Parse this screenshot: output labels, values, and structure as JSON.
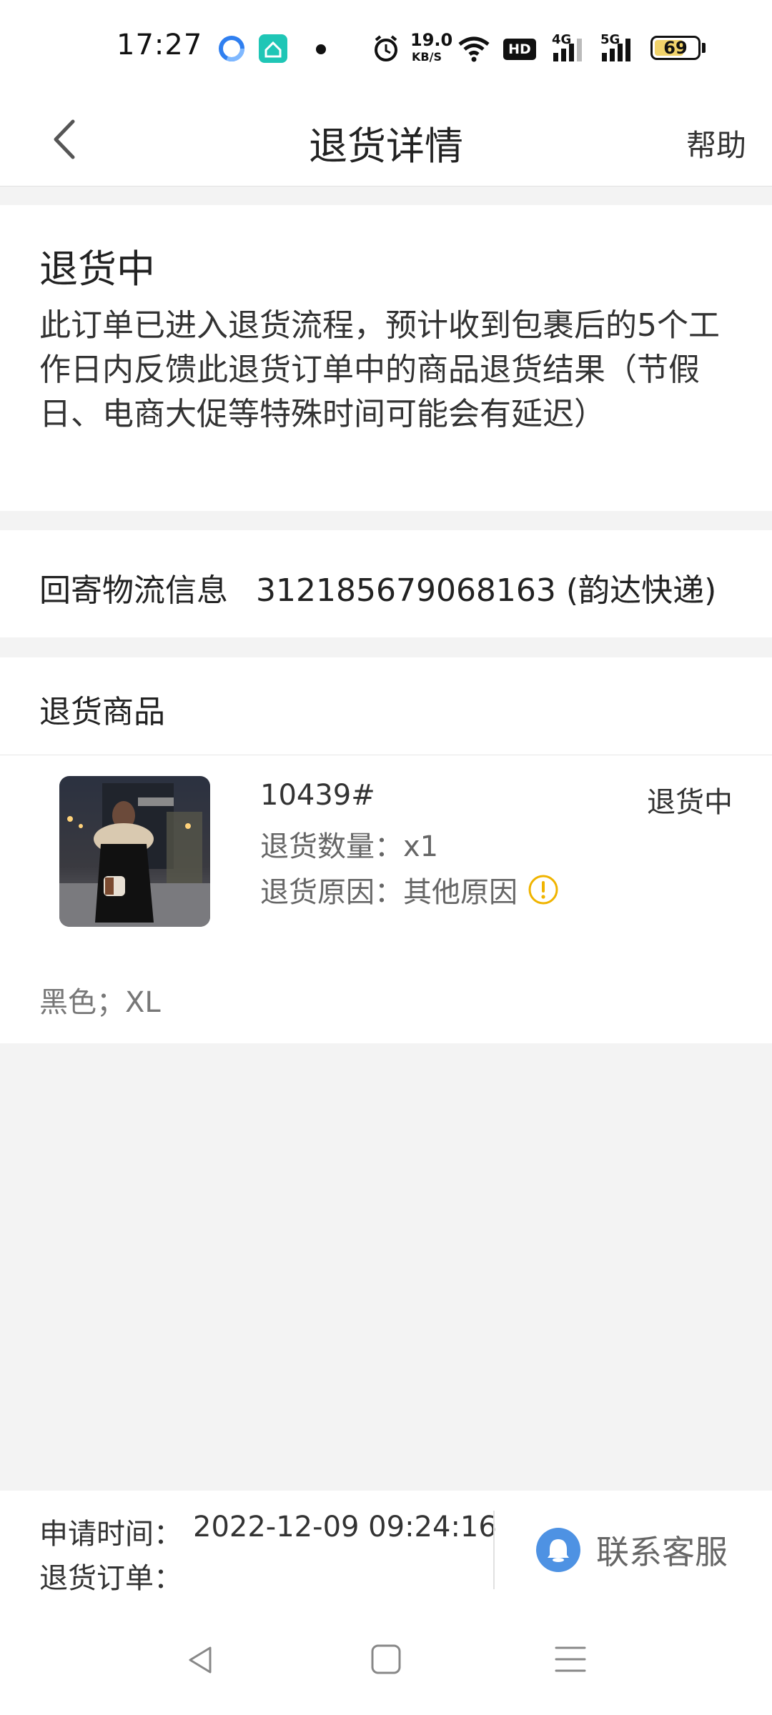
{
  "status_bar": {
    "time": "17:27",
    "net_speed_value": "19.0",
    "net_speed_unit": "KB/S",
    "hd1": "HD",
    "signal_4g": "4G",
    "signal_5g": "5G",
    "battery": "69",
    "battery_level": 0.69,
    "icons": [
      "browser-icon",
      "home-app-icon",
      "notification-dot-icon",
      "alarm-icon",
      "wifi-icon",
      "hd-voice-icon",
      "signal-4g-icon",
      "signal-5g-icon",
      "battery-icon"
    ]
  },
  "header": {
    "title": "退货详情",
    "help_label": "帮助",
    "back_icon": "chevron-left-icon"
  },
  "status": {
    "title": "退货中",
    "description": "此订单已进入退货流程，预计收到包裹后的5个工作日内反馈此退货订单中的商品退货结果（节假日、电商大促等特殊时间可能会有延迟）"
  },
  "logistics": {
    "label": "回寄物流信息",
    "value": "312185679068163 (韵达快递)"
  },
  "goods": {
    "header": "退货商品",
    "item": {
      "name": "10439#",
      "status": "退货中",
      "qty": "退货数量：x1",
      "reason": "退货原因：其他原因",
      "spec": "黑色；XL"
    }
  },
  "footer": {
    "apply_label": "申请时间：",
    "apply_time": "2022-12-09 09:24:16",
    "order_label": "退货订单：",
    "contact_label": "联系客服"
  },
  "colors": {
    "accent_blue": "#4e92e3",
    "warning_yellow": "#f0b400",
    "background": "#f3f3f3"
  }
}
